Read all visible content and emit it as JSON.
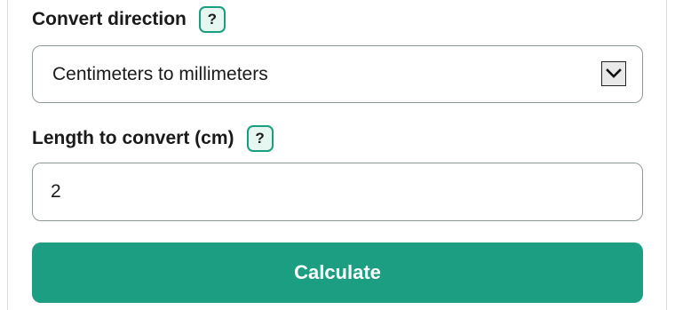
{
  "convert_direction": {
    "label": "Convert direction",
    "help_label": "?",
    "selected_option": "Centimeters to millimeters",
    "arrow_icon": "chevron-down-icon"
  },
  "length_field": {
    "label": "Length to convert (cm)",
    "help_label": "?",
    "value": "2"
  },
  "calculate_button": {
    "label": "Calculate"
  },
  "colors": {
    "accent": "#1b9e82",
    "help_badge_bg": "#e6f6f1",
    "field_border": "#8f9a97",
    "text": "#1a1a1a"
  }
}
